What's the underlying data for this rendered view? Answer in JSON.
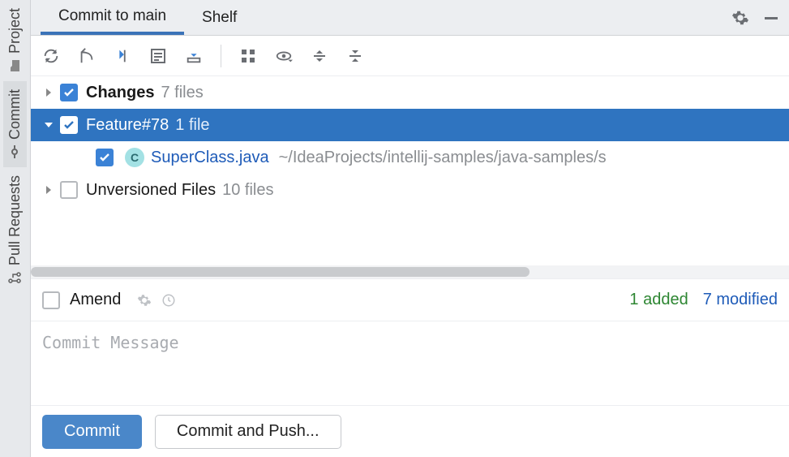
{
  "sidebar": {
    "items": [
      {
        "label": "Project"
      },
      {
        "label": "Commit"
      },
      {
        "label": "Pull Requests"
      }
    ]
  },
  "tabs": {
    "commit": "Commit to main",
    "shelf": "Shelf"
  },
  "tree": {
    "changes": {
      "label": "Changes",
      "count": "7 files"
    },
    "feature": {
      "label": "Feature#78",
      "count": "1 file"
    },
    "file": {
      "name": "SuperClass.java",
      "path": "~/IdeaProjects/intellij-samples/java-samples/s",
      "icon_letter": "C"
    },
    "unversioned": {
      "label": "Unversioned Files",
      "count": "10 files"
    }
  },
  "status": {
    "amend": "Amend",
    "added": "1 added",
    "modified": "7 modified"
  },
  "message": {
    "placeholder": "Commit Message"
  },
  "buttons": {
    "commit": "Commit",
    "commit_push": "Commit and Push..."
  }
}
